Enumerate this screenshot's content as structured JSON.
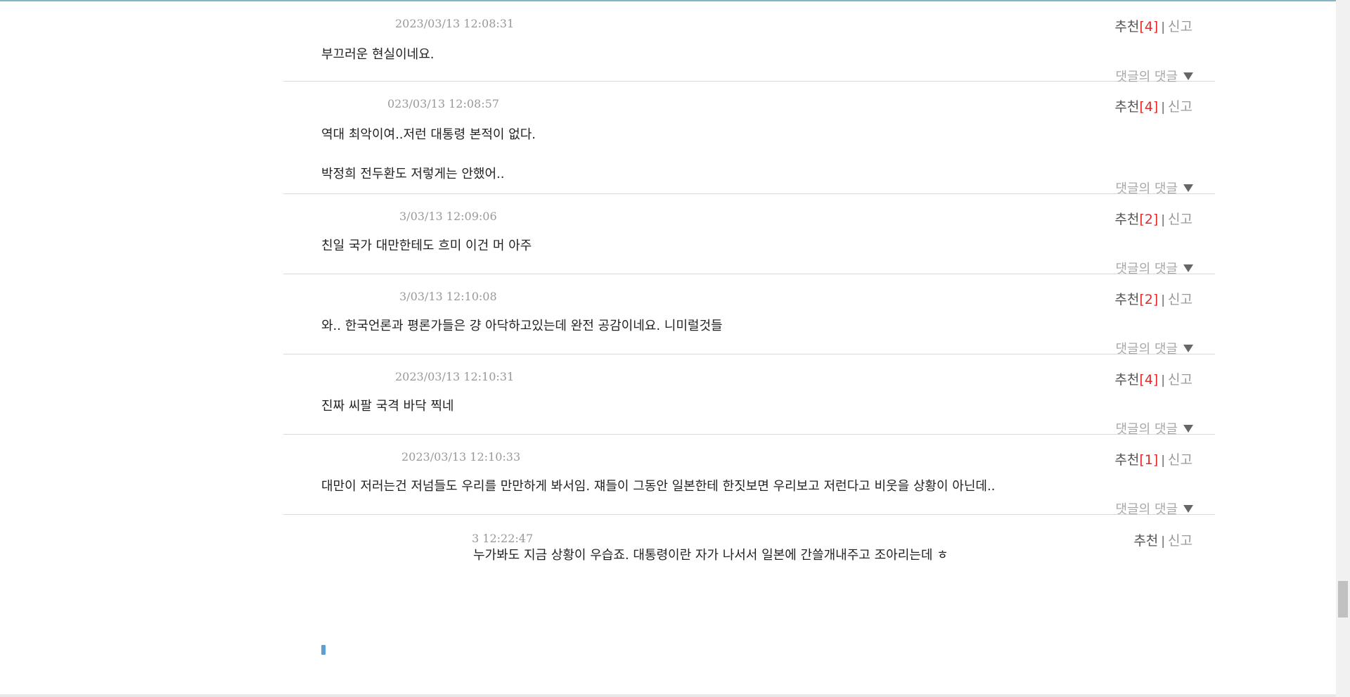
{
  "labels": {
    "recommend": "추천",
    "separator": "|",
    "report": "신고",
    "reply": "댓글의 댓글"
  },
  "comments": [
    {
      "date": "2023/03/13 12:08:31",
      "count": "[4]",
      "lines": [
        "부끄러운 현실이네요."
      ]
    },
    {
      "date": "023/03/13 12:08:57",
      "count": "[4]",
      "lines": [
        "역대 최악이여..저런 대통령 본적이 없다.",
        "박정희 전두환도 저렇게는 안했어.."
      ]
    },
    {
      "date": "3/03/13 12:09:06",
      "count": "[2]",
      "lines": [
        "친일 국가 대만한테도 흐미 이건 머 아주"
      ]
    },
    {
      "date": "3/03/13 12:10:08",
      "count": "[2]",
      "lines": [
        "와.. 한국언론과 평론가들은 걍 아닥하고있는데 완전 공감이네요. 니미럴것들"
      ]
    },
    {
      "date": "2023/03/13 12:10:31",
      "count": "[4]",
      "lines": [
        "진짜 씨팔 국격 바닥 찍네"
      ]
    },
    {
      "date": "2023/03/13 12:10:33",
      "count": "[1]",
      "lines": [
        "대만이 저러는건 저넘들도 우리를 만만하게 봐서임. 쟤들이 그동안 일본한테 한짓보면 우리보고 저런다고 비웃을 상황이 아닌데.."
      ]
    },
    {
      "date": "3 12:22:47",
      "count": "",
      "lines": [
        "누가봐도 지금 상황이 우습죠. 대통령이란 자가 나서서 일본에 간쓸개내주고 조아리는데 ㅎ"
      ]
    }
  ],
  "icons": {
    "reply_toggle": "triangle-down-icon"
  },
  "colors": {
    "count": "#e32b2b",
    "date": "#999999",
    "reply": "#a8a8a8"
  }
}
